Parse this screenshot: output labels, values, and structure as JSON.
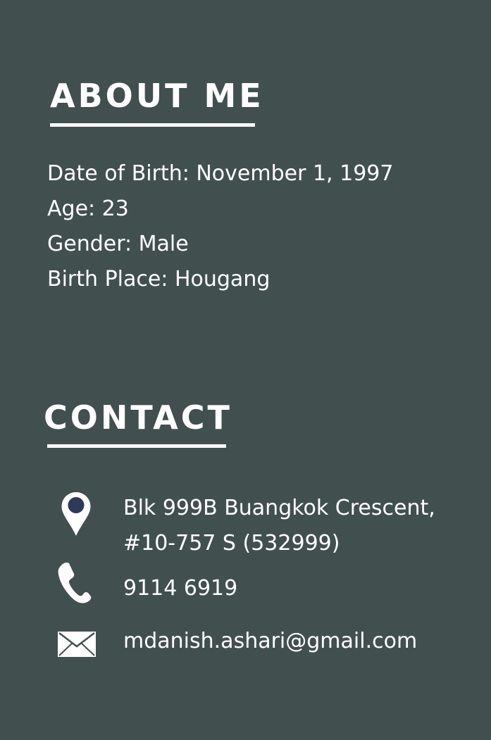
{
  "about": {
    "title": "ABOUT ME",
    "items": [
      "Date of Birth: November 1, 1997",
      "Age: 23",
      "Gender: Male",
      "Birth Place: Hougang"
    ]
  },
  "contact": {
    "title": "CONTACT",
    "address_line1": "Blk 999B Buangkok Crescent,",
    "address_line2": "#10-757 S (532999)",
    "phone": "9114 6919",
    "email": "mdanish.ashari@gmail.com"
  },
  "icons": {
    "address": "map-pin-icon",
    "phone": "phone-icon",
    "email": "envelope-icon"
  },
  "colors": {
    "background": "#424f4f",
    "text": "#ffffff",
    "pin_center": "#2f3a5a"
  }
}
